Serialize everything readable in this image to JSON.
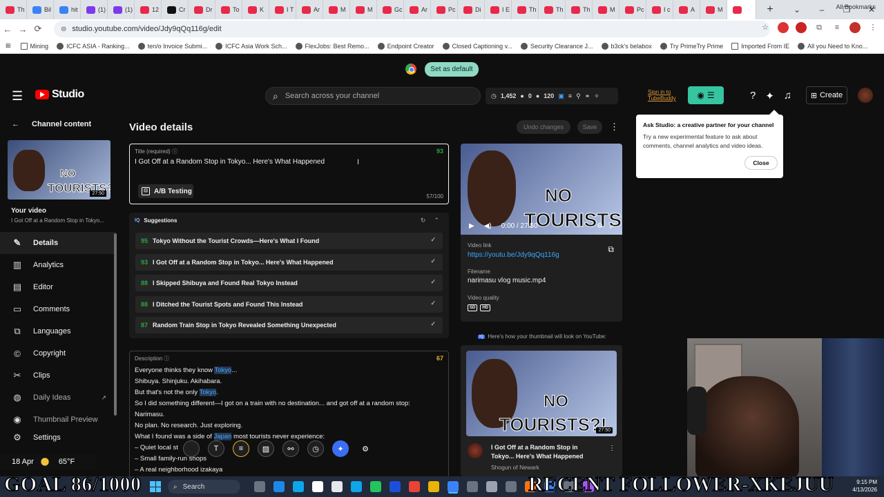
{
  "browser": {
    "tabs": [
      "Th",
      "Bil",
      "hit",
      "(1)",
      "(1)",
      "12",
      "Cr",
      "Dr",
      "To",
      "K",
      "I T",
      "Ar",
      "M",
      "M",
      "Gc",
      "Ar",
      "Pc",
      "Di",
      "I E",
      "Th",
      "Th",
      "Th",
      "M",
      "Pc",
      "I c",
      "A",
      "M",
      ""
    ],
    "tab_colors": [
      "#e8294a",
      "#3b82f6",
      "#3b82f6",
      "#7c3aed",
      "#7c3aed",
      "#e8294a",
      "#111111",
      "#e8294a",
      "#e8294a",
      "#e8294a",
      "#e8294a",
      "#e8294a",
      "#e8294a",
      "#e8294a",
      "#e8294a",
      "#e8294a",
      "#e8294a",
      "#e8294a",
      "#e8294a",
      "#e8294a",
      "#e8294a",
      "#e8294a",
      "#e8294a",
      "#e8294a",
      "#e8294a",
      "#e8294a",
      "#e8294a",
      "#e8294a"
    ],
    "new_tab": "+",
    "window_controls": [
      "⌄",
      "–",
      "❐",
      "✕"
    ],
    "url": "studio.youtube.com/video/Jdy9qQq116g/edit",
    "bookmarks": [
      {
        "label": "Mining",
        "icon": "folder-icon"
      },
      {
        "label": "ICFC ASIA - Ranking...",
        "icon": "globe-icon"
      },
      {
        "label": "ten/o Invoice Submi...",
        "icon": "globe-icon"
      },
      {
        "label": "ICFC Asia Work Sch...",
        "icon": "globe-icon"
      },
      {
        "label": "FlexJobs: Best Remo...",
        "icon": "globe-icon"
      },
      {
        "label": "Endpoint Creator",
        "icon": "globe-icon"
      },
      {
        "label": "Closed Captioning v...",
        "icon": "globe-icon"
      },
      {
        "label": "Security Clearance J...",
        "icon": "globe-icon"
      },
      {
        "label": "b3ck's belabox",
        "icon": "globe-icon"
      },
      {
        "label": "Try PrimeTry Prime",
        "icon": "globe-icon"
      },
      {
        "label": "Imported From IE",
        "icon": "folder-icon"
      },
      {
        "label": "All you Need to Kno...",
        "icon": "globe-icon"
      }
    ],
    "all_bookmarks": "All Bookmarks",
    "banner_button": "Set as default"
  },
  "studio": {
    "logo_text": "Studio",
    "search_placeholder": "Search across your channel",
    "stats": {
      "views": "1,452",
      "comments": "0",
      "count": "120"
    },
    "tubebuddy_link": "Sign in to TubeBuddy",
    "create_label": "Create"
  },
  "sidebar": {
    "back_label": "Channel content",
    "your_video": "Your video",
    "video_title": "I Got Off at a Random Stop in Tokyo...",
    "duration": "27:50",
    "thumb_line1": "NO",
    "thumb_line2": "TOURISTS?!",
    "items": [
      {
        "label": "Details",
        "icon": "pencil-icon"
      },
      {
        "label": "Analytics",
        "icon": "analytics-icon"
      },
      {
        "label": "Editor",
        "icon": "editor-icon"
      },
      {
        "label": "Comments",
        "icon": "comments-icon"
      },
      {
        "label": "Languages",
        "icon": "languages-icon"
      },
      {
        "label": "Copyright",
        "icon": "copyright-icon"
      },
      {
        "label": "Clips",
        "icon": "clips-icon"
      },
      {
        "label": "Daily Ideas",
        "icon": "ideas-icon"
      },
      {
        "label": "Thumbnail Preview",
        "icon": "preview-icon"
      },
      {
        "label": "Settings",
        "icon": "gear-icon"
      }
    ]
  },
  "main": {
    "heading": "Video details",
    "undo_label": "Undo changes",
    "save_label": "Save",
    "title_label": "Title (required)",
    "title_score": "93",
    "title_value": "I Got Off at a Random Stop in Tokyo... Here's What Happened",
    "title_count": "57/100",
    "ab_label": "A/B Testing",
    "suggestions_label": "Suggestions",
    "suggestions": [
      {
        "score": "95",
        "text": "Tokyo Without the Tourist Crowds—Here's What I Found"
      },
      {
        "score": "93",
        "text": "I Got Off at a Random Stop in Tokyo... Here's What Happened"
      },
      {
        "score": "88",
        "text": "I Skipped Shibuya and Found Real Tokyo Instead"
      },
      {
        "score": "88",
        "text": "I Ditched the Tourist Spots and Found This Instead"
      },
      {
        "score": "87",
        "text": "Random Train Stop in Tokyo Revealed Something Unexpected"
      }
    ],
    "description_label": "Description",
    "description_score": "67",
    "description_lines": [
      [
        "Everyone thinks they know ",
        "Tokyo",
        "..."
      ],
      [
        "Shibuya. Shinjuku. Akihabara.",
        "",
        ""
      ],
      [
        "But that's not the only ",
        "Tokyo",
        "."
      ],
      [
        "So I did something different—I got on a train with no destination... and got off at a random stop:",
        "",
        ""
      ],
      [
        "Narimasu.",
        "",
        ""
      ],
      [
        "No plan. No research. Just exploring.",
        "",
        ""
      ],
      [
        "What I found was a side of ",
        "Japan",
        " most tourists never experience:"
      ],
      [
        "– Quiet local st",
        "",
        ""
      ],
      [
        "– Small family-run shops",
        "",
        ""
      ],
      [
        "– A real neighborhood izakaya",
        "",
        ""
      ]
    ]
  },
  "right": {
    "time": "0:00 / 27:50",
    "video_link_label": "Video link",
    "video_link": "https://youtu.be/Jdy9qQq116g",
    "filename_label": "Filename",
    "filename": "narimasu vlog music.mp4",
    "quality_label": "Video quality",
    "quality_badges": [
      "SD",
      "HD"
    ],
    "preview_note": "Here's how your thumbnail will look on YouTube:",
    "preview_title": "I Got Off at a Random Stop in Tokyo... Here's What Happened",
    "preview_channel": "Shogun of Newark",
    "preview_duration": "27:50"
  },
  "popup": {
    "title": "Ask Studio: a creative partner for your channel",
    "body": "Try a new experimental feature to ask about comments, channel analytics and video ideas.",
    "close": "Close"
  },
  "overlay": {
    "weather_date": "18 Apr",
    "weather_temp": "65°F",
    "goal": "GOAL 86/1000",
    "follower": "RECENT FOLLOWER-XKEJUU"
  },
  "taskbar": {
    "search": "Search",
    "time": "9:15 PM",
    "date": "4/13/2026",
    "app_colors": [
      "#6b7280",
      "#1e88e5",
      "#0ea5e9",
      "#ffffff",
      "#e5e7eb",
      "#0ea5e9",
      "#22c55e",
      "#1d4ed8",
      "#ea4335",
      "#eab308",
      "#3b82f6",
      "#6b7280",
      "#9ca3af",
      "#6b7280",
      "#f97316",
      "#3b82f6",
      "#6b7280",
      "#a855f7"
    ]
  }
}
